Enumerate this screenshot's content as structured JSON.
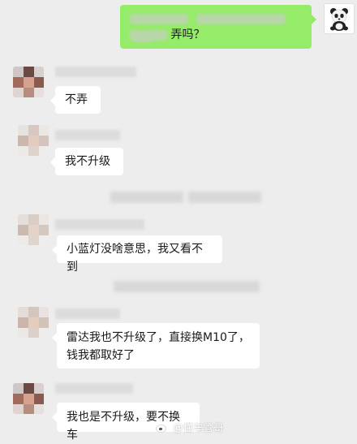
{
  "messages": [
    {
      "side": "out",
      "visible_text": "弄吗？"
    },
    {
      "side": "in",
      "text": "不弄"
    },
    {
      "side": "in",
      "text": "我不升级"
    },
    {
      "side": "in",
      "text": "小蓝灯没啥意思，我又看不到"
    },
    {
      "side": "in",
      "text_line1": "雷达我也不升级了，直接换M10了，",
      "text_line2": "钱我都取好了"
    },
    {
      "side": "in",
      "text": "我也是不升级，要不换车"
    }
  ],
  "watermark": {
    "text": "@懂车管哥"
  },
  "colors": {
    "background": "#ededed",
    "incoming": "#ffffff",
    "outgoing": "#95ec69"
  },
  "icons": {
    "self_avatar": "panda-avatar",
    "watermark_logo": "weibo-icon"
  }
}
